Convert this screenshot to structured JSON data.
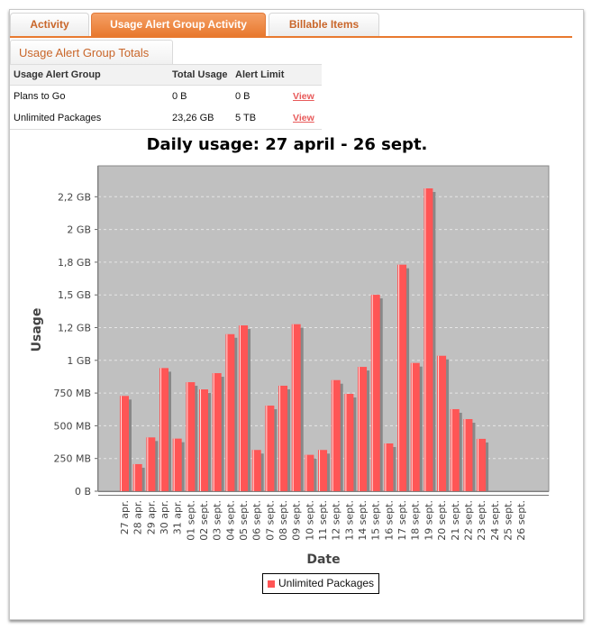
{
  "tabs": [
    {
      "label": "Activity",
      "active": false
    },
    {
      "label": "Usage Alert Group Activity",
      "active": true
    },
    {
      "label": "Billable Items",
      "active": false
    }
  ],
  "subtab": {
    "label": "Usage Alert Group Totals"
  },
  "totals_table": {
    "headers": [
      "Usage Alert Group",
      "Total Usage",
      "Alert Limit",
      ""
    ],
    "rows": [
      {
        "group": "Plans to Go",
        "total_usage": "0 B",
        "alert_limit": "0 B",
        "action": "View"
      },
      {
        "group": "Unlimited Packages",
        "total_usage": "23,26 GB",
        "alert_limit": "5 TB",
        "action": "View"
      }
    ]
  },
  "colors": {
    "accent": "#e8792f",
    "bar": "#ff5555",
    "plot_bg": "#c0c0c0",
    "link": "#e85a5a"
  },
  "chart_data": {
    "type": "bar",
    "title": "Daily usage: 27 april - 26 sept.",
    "xlabel": "Date",
    "ylabel": "Usage",
    "ylim_mb": [
      0,
      2450
    ],
    "grid": true,
    "legend_position": "bottom-center",
    "yticks": [
      {
        "value_mb": 0,
        "label": "0 B"
      },
      {
        "value_mb": 250,
        "label": "250 MB"
      },
      {
        "value_mb": 500,
        "label": "500 MB"
      },
      {
        "value_mb": 750,
        "label": "750 MB"
      },
      {
        "value_mb": 1000,
        "label": "1 GB"
      },
      {
        "value_mb": 1250,
        "label": "1,2 GB"
      },
      {
        "value_mb": 1500,
        "label": "1,5 GB"
      },
      {
        "value_mb": 1750,
        "label": "1,8 GB"
      },
      {
        "value_mb": 2000,
        "label": "2 GB"
      },
      {
        "value_mb": 2250,
        "label": "2,2 GB"
      }
    ],
    "categories": [
      "27 apr.",
      "28 apr.",
      "29 apr.",
      "30 apr.",
      "31 apr.",
      "01 sept.",
      "02 sept.",
      "03 sept.",
      "04 sept.",
      "05 sept.",
      "06 sept.",
      "07 sept.",
      "08 sept.",
      "09 sept.",
      "10 sept.",
      "11 sept.",
      "12 sept.",
      "13 sept.",
      "14 sept.",
      "15 sept.",
      "16 sept.",
      "17 sept.",
      "18 sept.",
      "19 sept.",
      "20 sept.",
      "21 sept.",
      "22 sept.",
      "23 sept.",
      "24 sept.",
      "25 sept.",
      "26 sept."
    ],
    "series": [
      {
        "name": "Unlimited Packages",
        "unit": "MB",
        "values": [
          728,
          207,
          411,
          941,
          402,
          833,
          778,
          902,
          1200,
          1267,
          315,
          654,
          806,
          1276,
          278,
          315,
          849,
          744,
          950,
          1501,
          365,
          1731,
          980,
          2314,
          1035,
          627,
          551,
          400,
          0,
          0,
          0
        ]
      }
    ]
  }
}
